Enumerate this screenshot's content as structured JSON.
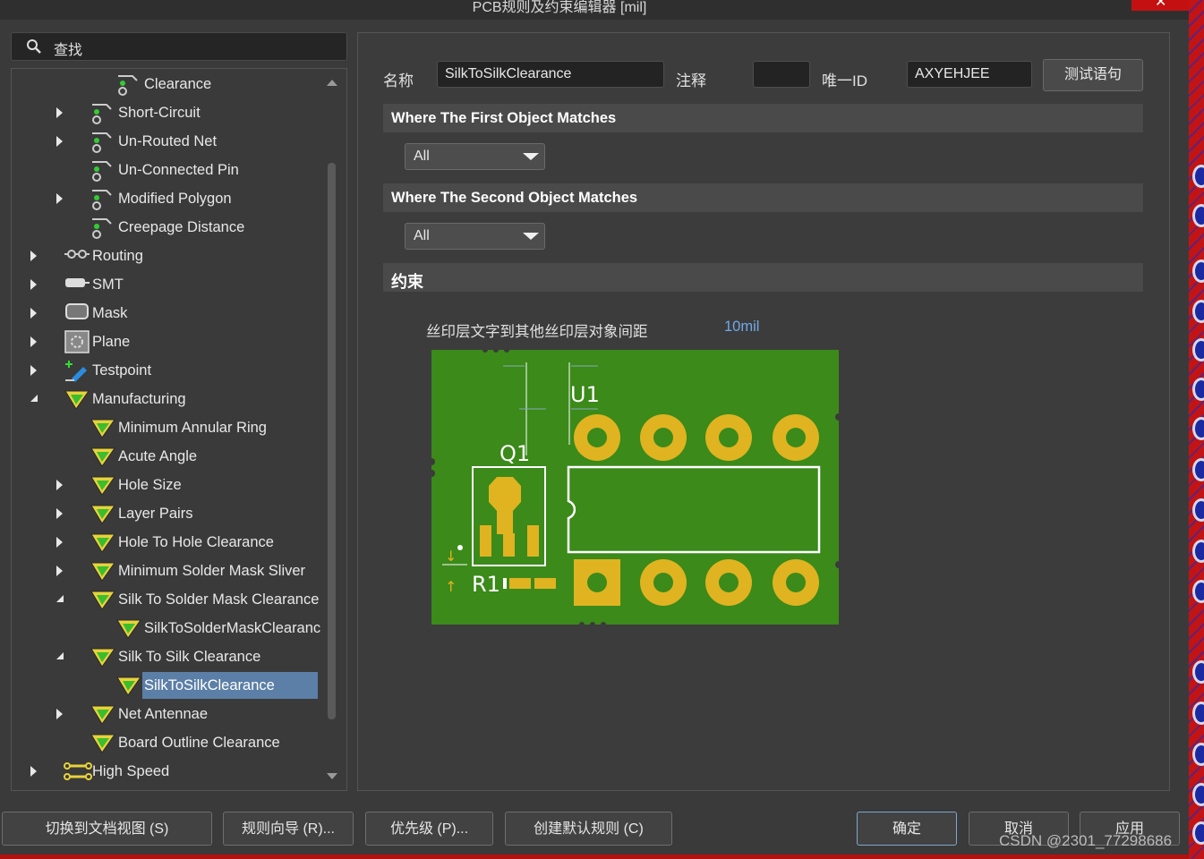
{
  "window": {
    "title": "PCB规则及约束编辑器 [mil]"
  },
  "search": {
    "placeholder": "查找"
  },
  "tree": {
    "items": [
      {
        "label": "Clearance",
        "icon": "clearance-icon"
      },
      {
        "label": "Short-Circuit",
        "icon": "clearance-icon"
      },
      {
        "label": "Un-Routed Net",
        "icon": "clearance-icon"
      },
      {
        "label": "Un-Connected Pin",
        "icon": "clearance-icon"
      },
      {
        "label": "Modified Polygon",
        "icon": "clearance-icon"
      },
      {
        "label": "Creepage Distance",
        "icon": "clearance-icon"
      },
      {
        "label": "Routing",
        "icon": "routing-icon"
      },
      {
        "label": "SMT",
        "icon": "smt-icon"
      },
      {
        "label": "Mask",
        "icon": "mask-icon"
      },
      {
        "label": "Plane",
        "icon": "plane-icon"
      },
      {
        "label": "Testpoint",
        "icon": "testpoint-icon"
      },
      {
        "label": "Manufacturing",
        "icon": "manufacturing-icon"
      },
      {
        "label": "Minimum Annular Ring",
        "icon": "manufacturing-icon"
      },
      {
        "label": "Acute Angle",
        "icon": "manufacturing-icon"
      },
      {
        "label": "Hole Size",
        "icon": "manufacturing-icon"
      },
      {
        "label": "Layer Pairs",
        "icon": "manufacturing-icon"
      },
      {
        "label": "Hole To Hole Clearance",
        "icon": "manufacturing-icon"
      },
      {
        "label": "Minimum Solder Mask Sliver",
        "icon": "manufacturing-icon"
      },
      {
        "label": "Silk To Solder Mask Clearance",
        "icon": "manufacturing-icon"
      },
      {
        "label": "SilkToSolderMaskClearanc",
        "icon": "manufacturing-icon"
      },
      {
        "label": "Silk To Silk Clearance",
        "icon": "manufacturing-icon"
      },
      {
        "label": "SilkToSilkClearance",
        "icon": "manufacturing-icon",
        "selected": true
      },
      {
        "label": "Net Antennae",
        "icon": "manufacturing-icon"
      },
      {
        "label": "Board Outline Clearance",
        "icon": "manufacturing-icon"
      },
      {
        "label": "High Speed",
        "icon": "high-speed-icon"
      }
    ]
  },
  "rule": {
    "name_label": "名称",
    "name_value": "SilkToSilkClearance",
    "comment_label": "注释",
    "comment_value": "",
    "uid_label": "唯一ID",
    "uid_value": "AXYEHJEE",
    "test_button": "测试语句"
  },
  "first_match": {
    "title": "Where The First Object Matches",
    "value": "All"
  },
  "second_match": {
    "title": "Where The Second Object Matches",
    "value": "All"
  },
  "constraints": {
    "title": "约束",
    "label": "丝印层文字到其他丝印层对象间距",
    "value": "10mil"
  },
  "diagram": {
    "u1": "U1",
    "q1": "Q1",
    "r1": "R1"
  },
  "bottom_buttons": {
    "doc_view": "切换到文档视图 (S)",
    "wizard": "规则向导 (R)...",
    "priority": "优先级 (P)...",
    "create_default": "创建默认规则 (C)",
    "ok": "确定",
    "cancel": "取消",
    "apply": "应用"
  },
  "watermark": "CSDN @2301_77298686",
  "colors": {
    "board": "#3b8a1a",
    "pad": "#e0b321",
    "accent": "#5b7fa6",
    "link": "#6fa8e8"
  }
}
